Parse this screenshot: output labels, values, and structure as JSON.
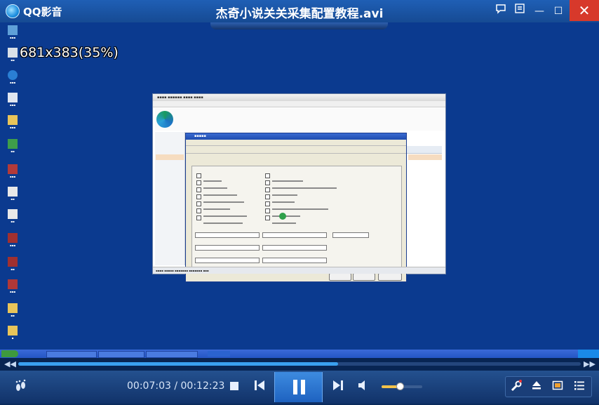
{
  "app": {
    "name": "QQ影音",
    "file_title": "杰奇小说关关采集配置教程.avi"
  },
  "titlebar": {
    "skin_icon": "chat-bubble-icon",
    "menu_icon": "menu-icon",
    "minimize": "—",
    "maximize": "☐",
    "close": "✕"
  },
  "video": {
    "osd_text": "681x383(35%)"
  },
  "playback": {
    "position": "00:07:03",
    "separator": " / ",
    "duration": "00:12:23",
    "progress_fraction": 0.569
  },
  "volume": {
    "level_fraction": 0.45
  },
  "icons": {
    "footprint": "footprint-icon",
    "stop": "stop-icon",
    "prev": "previous-icon",
    "pause": "pause-icon",
    "next": "next-icon",
    "speaker": "speaker-icon",
    "tools": "tools-icon",
    "eject": "eject-icon",
    "screenshot": "screenshot-icon",
    "playlist": "playlist-icon"
  },
  "colors": {
    "accent": "#3aa0f0",
    "close": "#d7392b",
    "volume": "#f2c24a"
  }
}
